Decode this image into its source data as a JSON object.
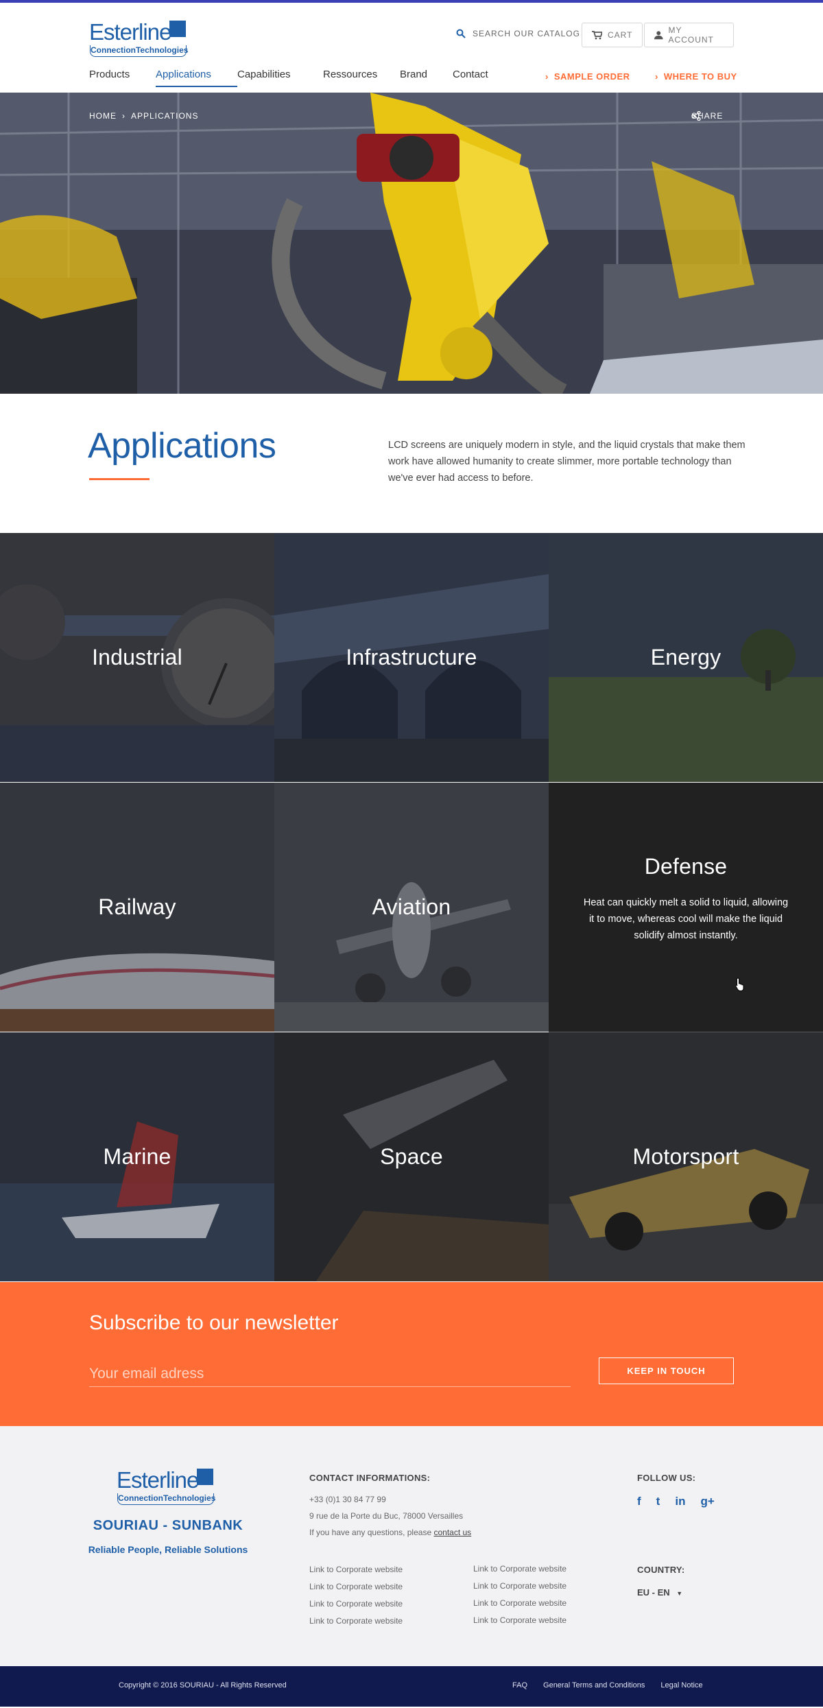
{
  "header": {
    "logo_text": "Esterline",
    "logo_sub": "ConnectionTechnologies",
    "search_label": "SEARCH OUR CATALOG",
    "cart_label": "CART",
    "account_label": "MY ACCOUNT",
    "nav": [
      {
        "label": "Products"
      },
      {
        "label": "Applications"
      },
      {
        "label": "Capabilities"
      },
      {
        "label": "Ressources"
      },
      {
        "label": "Brand"
      },
      {
        "label": "Contact"
      }
    ],
    "sample_order": "SAMPLE ORDER",
    "where_to_buy": "WHERE TO BUY",
    "accent": "#ff6c35",
    "brand": "#1f5fa8"
  },
  "hero": {
    "breadcrumb": [
      "HOME",
      "APPLICATIONS"
    ],
    "share_label": "SHARE"
  },
  "intro": {
    "title": "Applications",
    "text": "LCD screens are uniquely modern in style, and the liquid crystals that make them work have allowed humanity to create slimmer, more portable technology than we've ever had access to before."
  },
  "applications": [
    {
      "name": "Industrial"
    },
    {
      "name": "Infrastructure"
    },
    {
      "name": "Energy"
    },
    {
      "name": "Railway"
    },
    {
      "name": "Aviation"
    },
    {
      "name": "Defense",
      "description": "Heat can quickly melt a solid to liquid, allowing it to move, whereas cool will make the liquid solidify almost instantly."
    },
    {
      "name": "Marine"
    },
    {
      "name": "Space"
    },
    {
      "name": "Motorsport"
    }
  ],
  "newsletter": {
    "title": "Subscribe to our newsletter",
    "placeholder": "Your email adress",
    "button": "KEEP IN TOUCH"
  },
  "footer": {
    "brand": "SOURIAU - SUNBANK",
    "slogan": "Reliable People, Reliable Solutions",
    "contact_heading": "CONTACT INFORMATIONS:",
    "phone": "+33 (0)1 30 84 77 99",
    "address": "9 rue de la Porte du Buc, 78000 Versailles",
    "questions": "If you have any questions, please",
    "contact_link": "contact us",
    "links_col1": [
      "Link to Corporate website",
      "Link to Corporate website",
      "Link to Corporate website",
      "Link to Corporate website"
    ],
    "links_col2": [
      "Link to Corporate website",
      "Link to Corporate website",
      "Link to Corporate website",
      "Link to Corporate website"
    ],
    "follow_heading": "FOLLOW US:",
    "social": [
      "f",
      "t",
      "in",
      "g+"
    ],
    "country_heading": "COUNTRY:",
    "country_value": "EU - EN"
  },
  "bottom": {
    "copyright": "Copyright © 2016 SOURIAU - All Rights Reserved",
    "links": [
      "FAQ",
      "General Terms and Conditions",
      "Legal Notice"
    ]
  }
}
